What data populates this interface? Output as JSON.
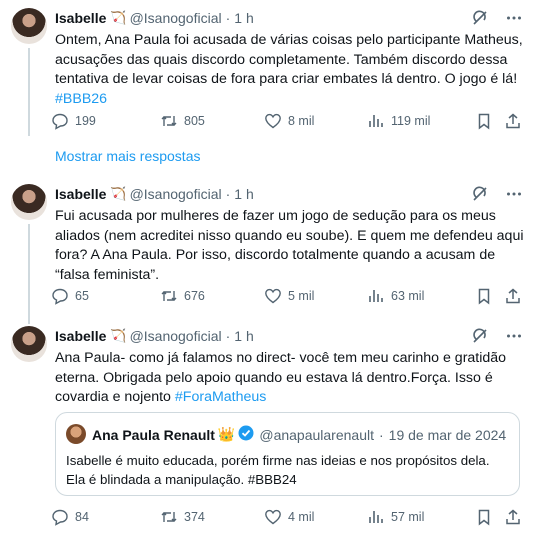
{
  "tweets": [
    {
      "name": "Isabelle",
      "emoji": "🏹",
      "handle": "@Isanogoficial",
      "dot": "·",
      "time": "1 h",
      "text": "Ontem, Ana Paula foi acusada de várias coisas pelo participante Matheus, acusações das quais discordo completamente. Também discordo dessa tentativa de levar coisas de fora para criar embates lá dentro. O jogo é lá!",
      "hashtag": "#BBB26",
      "replies": "199",
      "retweets": "805",
      "likes": "8 mil",
      "views": "119 mil"
    },
    {
      "name": "Isabelle",
      "emoji": "🏹",
      "handle": "@Isanogoficial",
      "dot": "·",
      "time": "1 h",
      "text": "Fui acusada por mulheres de fazer um jogo de sedução para os meus aliados (nem acreditei nisso quando eu soube). E quem me defendeu aqui fora? A Ana Paula. Por isso, discordo totalmente quando a acusam de “falsa feminista”.",
      "replies": "65",
      "retweets": "676",
      "likes": "5 mil",
      "views": "63 mil"
    },
    {
      "name": "Isabelle",
      "emoji": "🏹",
      "handle": "@Isanogoficial",
      "dot": "·",
      "time": "1 h",
      "text": "Ana Paula- como já falamos no direct- você tem meu carinho e gratidão eterna. Obrigada pelo apoio quando eu estava lá dentro.Força. Isso é covardia e nojento",
      "hashtag": "#ForaMatheus",
      "replies": "84",
      "retweets": "374",
      "likes": "4 mil",
      "views": "57 mil"
    }
  ],
  "show_more": "Mostrar mais respostas",
  "quote": {
    "name": "Ana Paula Renault",
    "emoji": "👑",
    "handle": "@anapaularenault",
    "dot": "·",
    "date": "19 de mar de 2024",
    "text": "Isabelle é muito educada, porém firme nas ideias e nos propósitos dela. Ela é blindada a manipulação.",
    "hashtag": "#BBB24"
  },
  "colors": {
    "accent": "#1d9bf0",
    "text": "#0f1419",
    "muted": "#536471",
    "border": "#cfd9de",
    "verified": "#1d9bf0"
  },
  "icons": {
    "top": [
      "grok-icon",
      "more-icon"
    ],
    "actions": [
      "reply-icon",
      "retweet-icon",
      "like-icon",
      "views-icon",
      "bookmark-icon",
      "share-icon"
    ]
  }
}
